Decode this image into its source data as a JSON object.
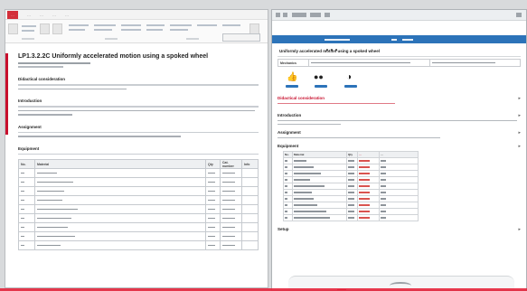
{
  "left_window": {
    "ribbon_tabs": [
      "…",
      "…",
      "…",
      "…",
      "…"
    ],
    "doc_title": "LP1.3.2.2C Uniformly accelerated motion using a spoked wheel",
    "sections": [
      {
        "heading": "Didactical consideration",
        "lines": 1
      },
      {
        "heading": "Introduction",
        "lines": 2
      },
      {
        "heading": "Assignment",
        "lines": 1
      },
      {
        "heading": "Equipment",
        "lines": 0
      }
    ],
    "equipment_table": {
      "headers": [
        "No.",
        "Material",
        "Qty",
        "Cat. number",
        "Info"
      ],
      "rows": 9
    }
  },
  "right_window": {
    "header_title": "…",
    "title": "Uniformly accelerated motion using a spoked wheel",
    "subject_cell": "Mechanics",
    "icon_labels": [
      "…",
      "…",
      "…"
    ],
    "sections": [
      {
        "heading": "Didactical consideration",
        "red": true
      },
      {
        "heading": "Introduction",
        "red": false
      },
      {
        "heading": "Assignment",
        "red": false
      },
      {
        "heading": "Equipment",
        "red": false
      },
      {
        "heading": "Setup",
        "red": false
      }
    ],
    "equipment_table": {
      "headers": [
        "No.",
        "Material",
        "Qty",
        "…",
        "…"
      ],
      "rows": 10
    }
  },
  "colors": {
    "accent_red": "#c8102e",
    "accent_blue": "#2c73b9"
  }
}
